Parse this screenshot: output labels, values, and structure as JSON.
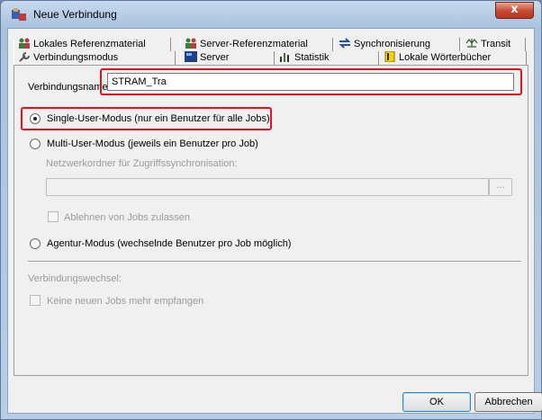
{
  "window": {
    "title": "Neue Verbindung",
    "close_label": "x"
  },
  "tabs": {
    "back_row": [
      {
        "label": "Lokales Referenzmaterial",
        "icon": "people-icon"
      },
      {
        "label": "Server-Referenzmaterial",
        "icon": "people-icon"
      },
      {
        "label": "Synchronisierung",
        "icon": "sync-arrows-icon"
      },
      {
        "label": "Transit",
        "icon": "scale-icon"
      }
    ],
    "front_row": [
      {
        "label": "Verbindungsmodus",
        "icon": "wrench-icon"
      },
      {
        "label": "Server",
        "icon": "server-icon"
      },
      {
        "label": "Statistik",
        "icon": "statistics-icon"
      },
      {
        "label": "Lokale Wörterbücher",
        "icon": "dictionary-icon"
      }
    ],
    "active": "Verbindungsmodus"
  },
  "form": {
    "connection_name_label": "Verbindungsname:",
    "connection_name_value": "STRAM_Tra",
    "single_user_label": "Single-User-Modus (nur ein Benutzer für alle Jobs)",
    "multi_user_label": "Multi-User-Modus (jeweils ein Benutzer pro Job)",
    "network_folder_label": "Netzwerkordner für Zugriffssynchronisation:",
    "network_folder_value": "",
    "browse_label": "...",
    "reject_jobs_label": "Ablehnen von Jobs zulassen",
    "agent_mode_label": "Agentur-Modus (wechselnde Benutzer pro Job möglich)",
    "connection_change_label": "Verbindungswechsel:",
    "no_new_jobs_label": "Keine neuen Jobs mehr empfangen",
    "selected_mode": "single-user"
  },
  "buttons": {
    "ok": "OK",
    "cancel": "Abbrechen"
  },
  "colors": {
    "highlight": "#e5121f",
    "close_button": "#c7462e"
  }
}
